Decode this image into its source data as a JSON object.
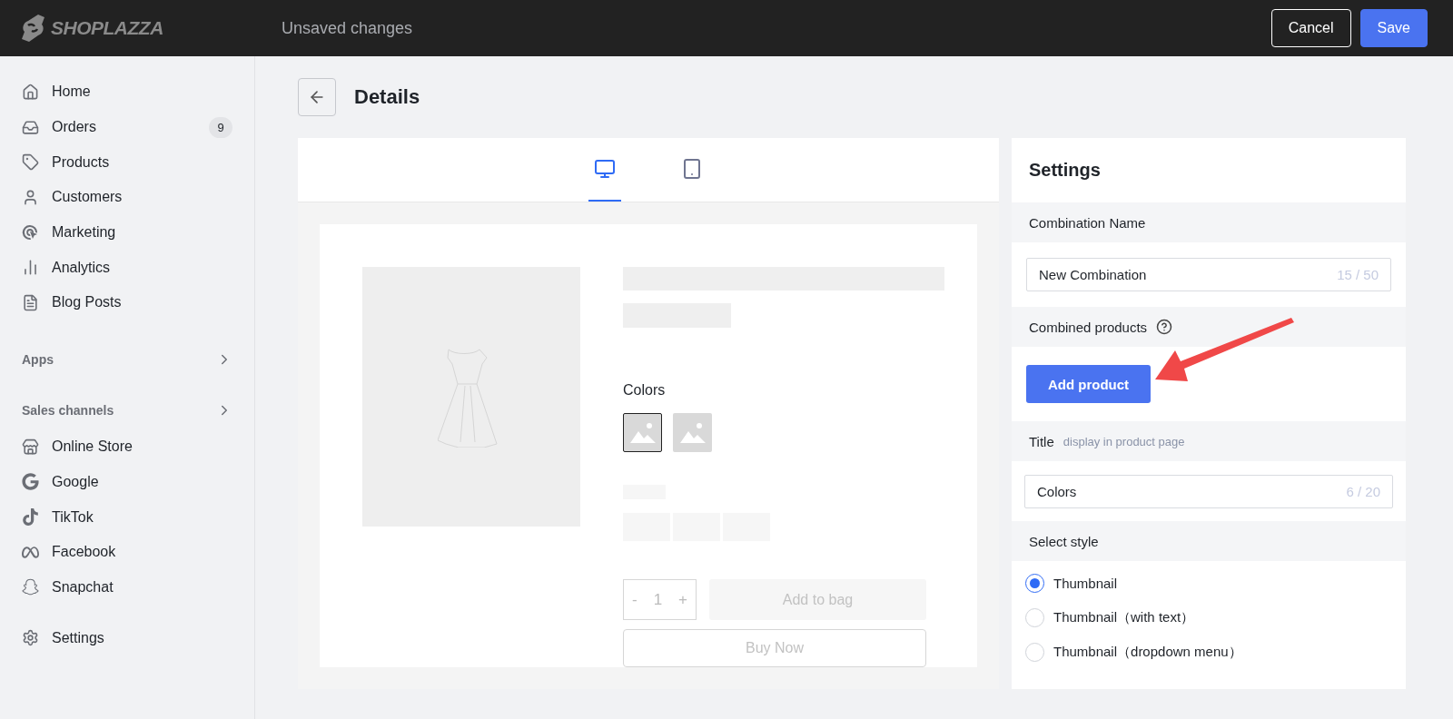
{
  "topbar": {
    "logo": "SHOPLAZZA",
    "status": "Unsaved changes",
    "buttons": [
      {
        "label": "Cancel",
        "kind": "secondary"
      },
      {
        "label": "Save",
        "kind": "primary"
      }
    ]
  },
  "sidebar": {
    "main_items": [
      {
        "label": "Home"
      },
      {
        "label": "Orders",
        "badge": "9"
      },
      {
        "label": "Products"
      },
      {
        "label": "Customers"
      },
      {
        "label": "Marketing"
      },
      {
        "label": "Analytics"
      },
      {
        "label": "Blog Posts"
      }
    ],
    "apps_header": "Apps",
    "sales_header": "Sales channels",
    "channel_items": [
      {
        "label": "Online Store"
      },
      {
        "label": "Google"
      },
      {
        "label": "TikTok"
      },
      {
        "label": "Facebook"
      },
      {
        "label": "Snapchat"
      }
    ],
    "settings_item": {
      "label": "Settings"
    }
  },
  "page": {
    "title": "Details"
  },
  "preview": {
    "device_tabs": [
      {
        "selected": true
      },
      {
        "selected": false
      }
    ],
    "colors_label": "Colors",
    "swatches": [
      {
        "selected": true
      },
      {
        "selected": false
      }
    ],
    "quantity": {
      "minus": "-",
      "value": "1",
      "plus": "+"
    },
    "add_to_bag": "Add to bag",
    "buy_now": "Buy Now"
  },
  "settings": {
    "title": "Settings",
    "combination_name": {
      "label": "Combination Name",
      "value": "New Combination",
      "counter": "15 / 50"
    },
    "combined_products": {
      "label": "Combined products",
      "button": "Add product"
    },
    "title_field": {
      "label": "Title",
      "hint": "display in product page",
      "value": "Colors",
      "counter": "6 / 20"
    },
    "select_style": {
      "label": "Select style",
      "options": [
        {
          "label": "Thumbnail",
          "selected": true
        },
        {
          "label": "Thumbnail（with text）",
          "selected": false
        },
        {
          "label": "Thumbnail（dropdown menu）",
          "selected": false
        }
      ]
    }
  }
}
